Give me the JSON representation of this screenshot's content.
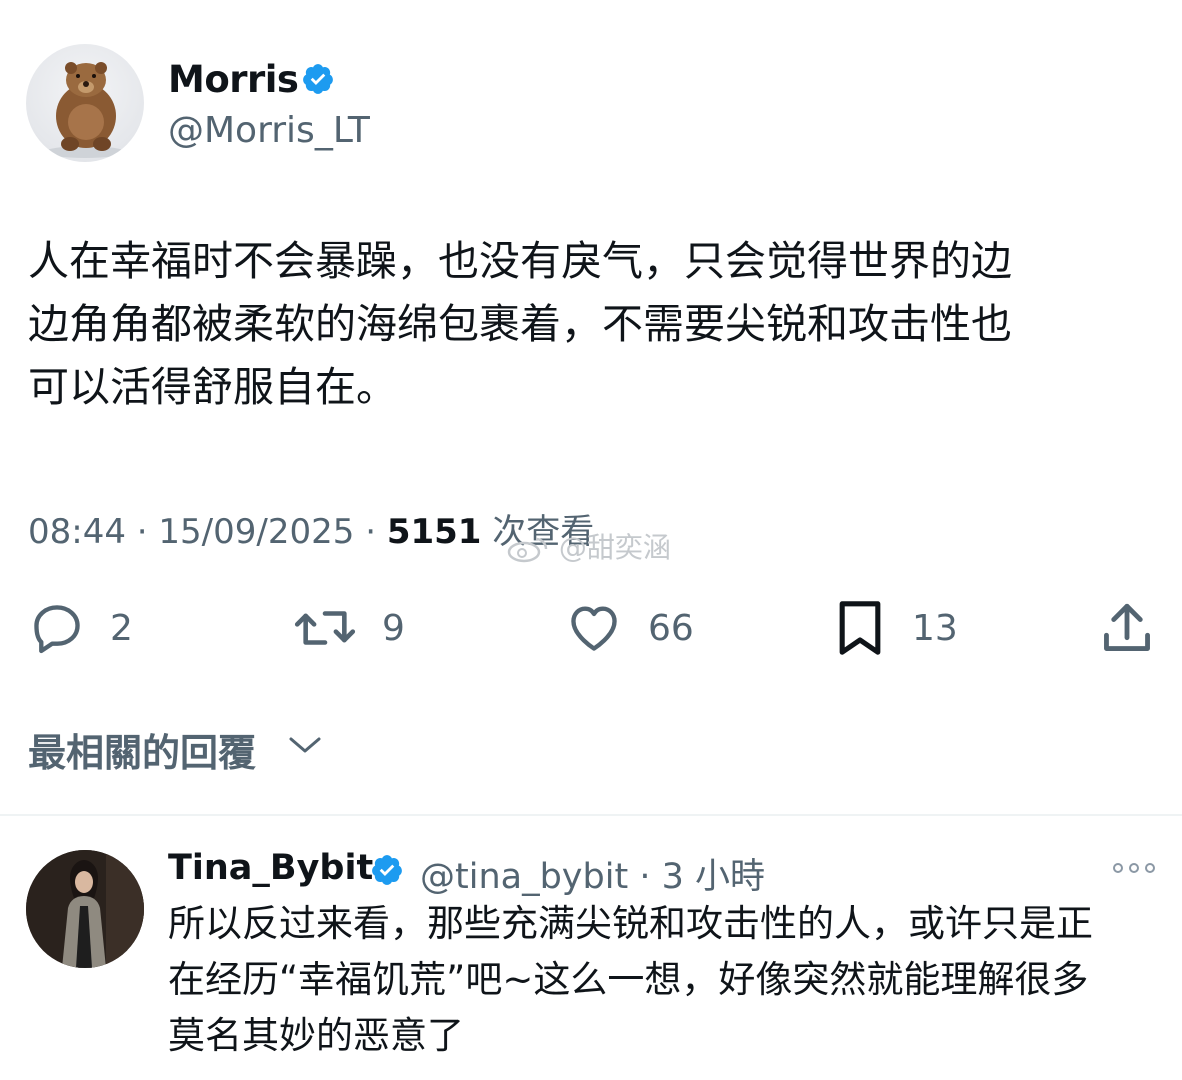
{
  "tweet": {
    "author": {
      "display_name": "Morris",
      "handle": "@Morris_LT",
      "avatar_icon": "bear-avatar",
      "verified": true
    },
    "text": "人在幸福时不会暴躁，也没有戾气，只会觉得世界的边\n边角角都被柔软的海绵包裹着，不需要尖锐和攻击性也\n可以活得舒服自在。",
    "meta": {
      "time": "08:44",
      "separator": "·",
      "date": "15/09/2025",
      "views": "5151",
      "views_label": "次查看"
    },
    "actions": {
      "replies": "2",
      "retweets": "9",
      "likes": "66",
      "bookmarks": "13"
    }
  },
  "watermark": "@甜奕涵",
  "replies_sort_label": "最相關的回覆",
  "reply": {
    "display_name": "Tina_Bybit",
    "handle": "@tina_bybit",
    "separator": "·",
    "time": "3 小時",
    "verified": true,
    "text": "所以反过来看，那些充满尖锐和攻击性的人，或许只是正\n在经历“幸福饥荒”吧~这么一想，好像突然就能理解很多\n莫名其妙的恶意了"
  },
  "colors": {
    "verified_blue": "#1d9bf0",
    "text_primary": "#0f1419",
    "text_secondary": "#536471"
  }
}
